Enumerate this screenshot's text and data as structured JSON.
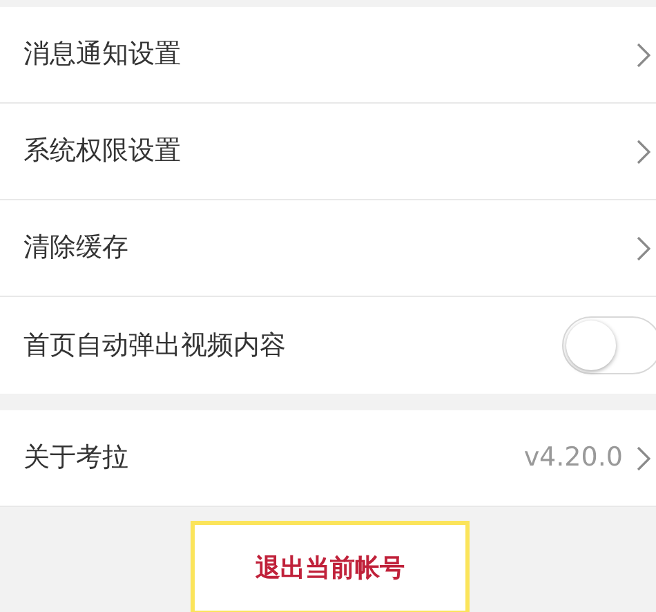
{
  "settings_groups": [
    {
      "items": [
        {
          "kind": "link",
          "label": "消息通知设置"
        },
        {
          "kind": "link",
          "label": "系统权限设置"
        },
        {
          "kind": "link",
          "label": "清除缓存"
        },
        {
          "kind": "toggle",
          "label": "首页自动弹出视频内容",
          "on": false
        }
      ]
    },
    {
      "items": [
        {
          "kind": "link",
          "label": "关于考拉",
          "value": "v4.20.0"
        }
      ]
    }
  ],
  "logout_button": {
    "label": "退出当前帐号",
    "highlighted": true
  }
}
